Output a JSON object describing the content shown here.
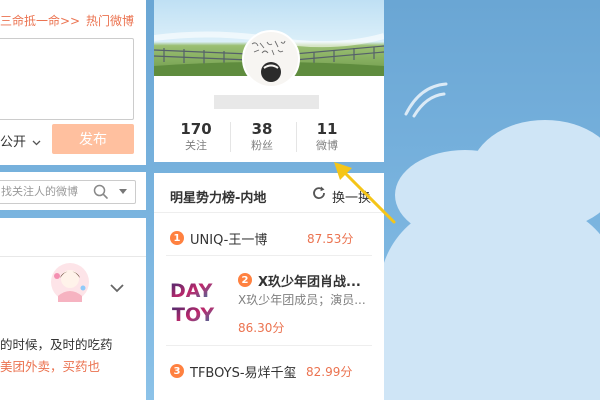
{
  "compose": {
    "mention_link": "三命抵一命>>",
    "hot_link": "热门微博",
    "visibility": "公开",
    "publish_label": "发布"
  },
  "search": {
    "placeholder": "找关注人的微博"
  },
  "feed": {
    "line1": "的时候，及时的吃药",
    "line2": "美团外卖，买药也"
  },
  "profile": {
    "stats": [
      {
        "count": "170",
        "label": "关注"
      },
      {
        "count": "38",
        "label": "粉丝"
      },
      {
        "count": "11",
        "label": "微博"
      }
    ]
  },
  "ranking": {
    "title": "明星势力榜-内地",
    "refresh_label": "换一换",
    "items": [
      {
        "rank": "1",
        "name": "UNIQ-王一博",
        "score": "87.53分"
      },
      {
        "rank": "2",
        "name": "X玖少年团肖战...",
        "desc": "X玖少年团成员；演员...",
        "score": "86.30分",
        "logo_line1": "DAY",
        "logo_line2": "TOY"
      },
      {
        "rank": "3",
        "name": "TFBOYS-易烊千玺",
        "score": "82.99分"
      }
    ]
  },
  "colors": {
    "accent": "#eb7350",
    "rank_badge": "#ff8140",
    "publish_disabled": "#ffc09f",
    "arrow": "#f5c518"
  }
}
